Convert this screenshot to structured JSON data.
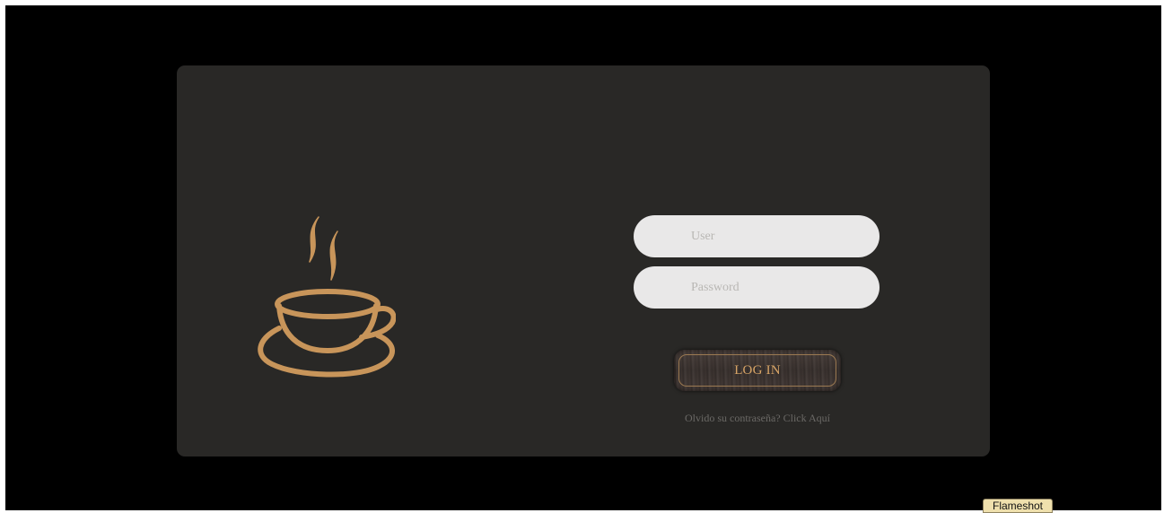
{
  "login": {
    "user_placeholder": "User",
    "password_placeholder": "Password",
    "login_button_label": "LOG IN",
    "forgot_password_text": "Olvido su contraseña? Click Aquí"
  },
  "logo": {
    "icon": "coffee-cup-icon",
    "color": "#c8955a"
  },
  "colors": {
    "background": "#000000",
    "card": "#292826",
    "input": "#e9e8e8",
    "button_text": "#d7a466",
    "link_text": "#6b6966"
  },
  "taskbar": {
    "flameshot_label": "Flameshot"
  }
}
